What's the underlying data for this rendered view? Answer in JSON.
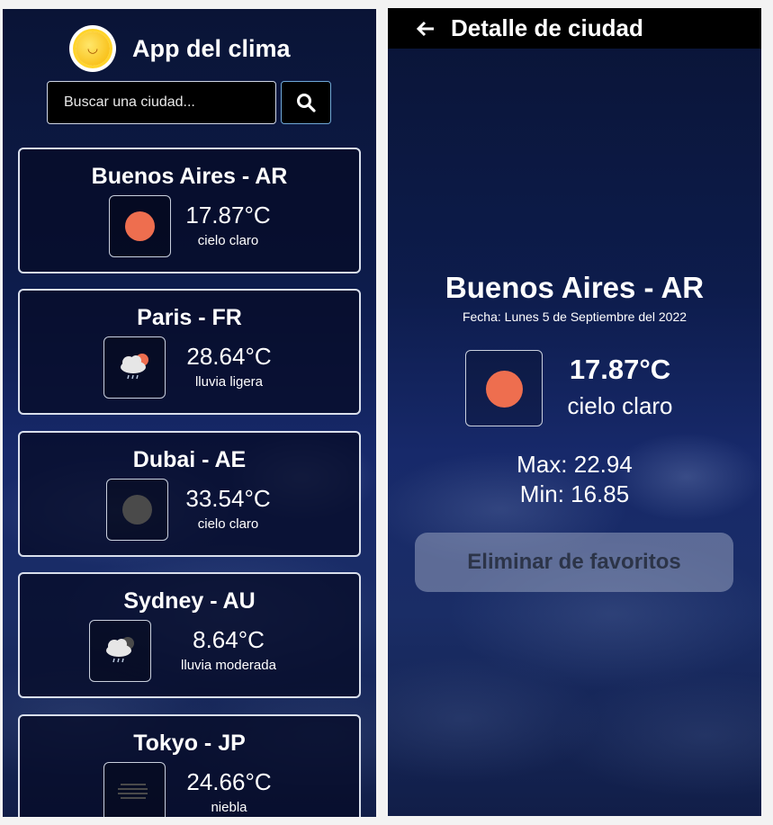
{
  "app": {
    "logo_icon": "smiling-sun-icon",
    "title": "App del clima"
  },
  "search": {
    "placeholder": "Buscar una ciudad...",
    "value": "",
    "button_icon": "search-icon"
  },
  "cards": [
    {
      "city": "Buenos Aires - AR",
      "temp": "17.87°C",
      "desc": "cielo claro",
      "icon": "clear-sky-icon",
      "icon_color": "#ee6e4f"
    },
    {
      "city": "Paris - FR",
      "temp": "28.64°C",
      "desc": "lluvia ligera",
      "icon": "light-rain-icon",
      "icon_color": "#ee6e4f"
    },
    {
      "city": "Dubai - AE",
      "temp": "33.54°C",
      "desc": "cielo claro",
      "icon": "clear-night-icon",
      "icon_color": "#4a4a4a"
    },
    {
      "city": "Sydney - AU",
      "temp": "8.64°C",
      "desc": "lluvia moderada",
      "icon": "moderate-rain-icon",
      "icon_color": "#4a4a4a"
    },
    {
      "city": "Tokyo - JP",
      "temp": "24.66°C",
      "desc": "niebla",
      "icon": "fog-icon",
      "icon_color": "#4a4a4a"
    }
  ],
  "detail": {
    "header_title": "Detalle de ciudad",
    "back_icon": "arrow-left-icon",
    "city": "Buenos Aires - AR",
    "date": "Fecha: Lunes 5 de Septiembre del 2022",
    "temp": "17.87°C",
    "desc": "cielo claro",
    "icon": "clear-sky-icon",
    "icon_color": "#ee6e4f",
    "max": "Max: 22.94",
    "min": "Min: 16.85",
    "remove_button": "Eliminar de favoritos"
  }
}
